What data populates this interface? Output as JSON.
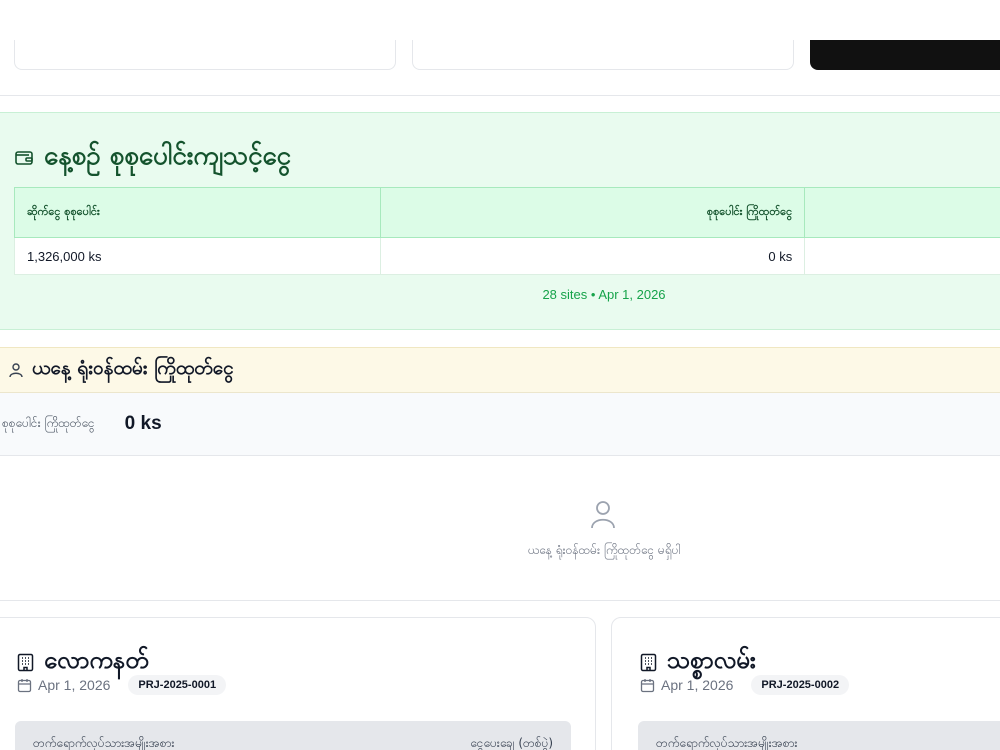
{
  "daily_summary": {
    "title": "နေ့စဉ် စုစုပေါင်းကျသင့်ငွေ",
    "icon": "wallet-icon",
    "columns": [
      "ဆိုက်ငွေ စုစုပေါင်း",
      "စုစုပေါင်း ကြိုထုတ်ငွေ",
      ""
    ],
    "row": [
      "1,326,000 ks",
      "0 ks",
      ""
    ],
    "footnote": "28 sites • Apr 1, 2026"
  },
  "staff_advance": {
    "title": "ယနေ့ ရုံးဝန်ထမ်း ကြိုထုတ်ငွေ",
    "icon": "user-icon",
    "summary_label": "စုစုပေါင်း ကြိုထုတ်ငွေ",
    "summary_value": "0 ks",
    "empty_message": "ယနေ့ ရုံးဝန်ထမ်း ကြိုထုတ်ငွေ မရှိပါ"
  },
  "projects": [
    {
      "name": "လောကနတ်",
      "date": "Apr 1, 2026",
      "code": "PRJ-2025-0001",
      "detail_left": "တက်ရောက်လုပ်သားအမျိုးအစား",
      "detail_right": "ငွေပေးချေ (တစ်ပွဲ)"
    },
    {
      "name": "သစ္စာလမ်း",
      "date": "Apr 1, 2026",
      "code": "PRJ-2025-0002",
      "detail_left": "တက်ရောက်လုပ်သားအမျိုးအစား",
      "detail_right": ""
    }
  ],
  "colors": {
    "green_panel": "#e9fbef",
    "green_text": "#14532d",
    "accent_green": "#16a34a",
    "yellow_panel": "#fdf9e7"
  }
}
